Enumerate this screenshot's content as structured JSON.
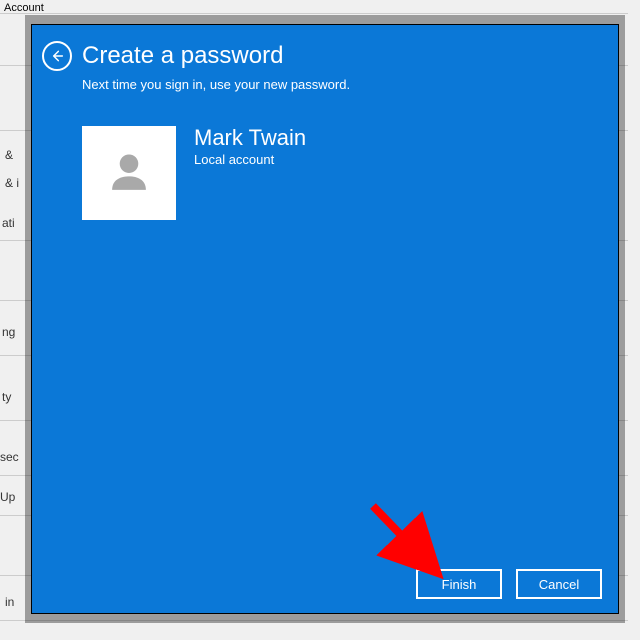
{
  "background": {
    "window_title": "Account",
    "fragments": [
      "&",
      "& i",
      "ati",
      "ng",
      "ty",
      "sec",
      "Up",
      "in"
    ]
  },
  "modal": {
    "title": "Create a password",
    "subtitle": "Next time you sign in, use your new password.",
    "user": {
      "name": "Mark Twain",
      "account_type": "Local account"
    },
    "buttons": {
      "finish": "Finish",
      "cancel": "Cancel"
    }
  },
  "annotation": {
    "arrow_color": "#ff0000"
  }
}
